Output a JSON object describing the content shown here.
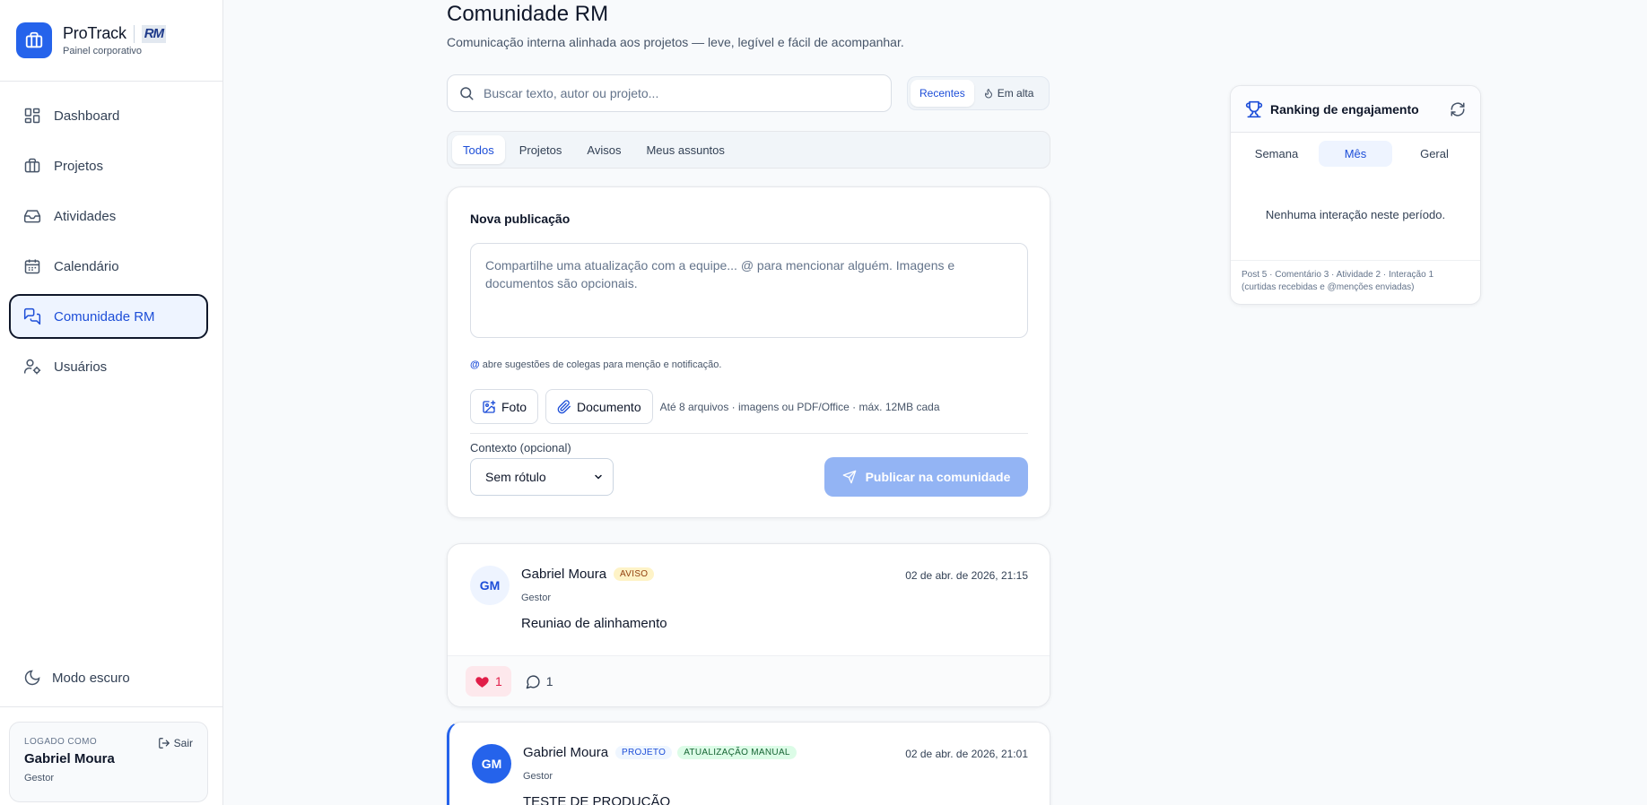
{
  "brand": {
    "name": "ProTrack",
    "badge": "RM",
    "subtitle": "Painel corporativo"
  },
  "sidebar": {
    "items": [
      {
        "label": "Dashboard",
        "icon": "dashboard-icon",
        "active": false
      },
      {
        "label": "Projetos",
        "icon": "briefcase-icon",
        "active": false
      },
      {
        "label": "Atividades",
        "icon": "inbox-icon",
        "active": false
      },
      {
        "label": "Calendário",
        "icon": "calendar-icon",
        "active": false
      },
      {
        "label": "Comunidade RM",
        "icon": "messages-icon",
        "active": true
      },
      {
        "label": "Usuários",
        "icon": "user-settings-icon",
        "active": false
      }
    ],
    "dark_mode_label": "Modo escuro",
    "user": {
      "label": "LOGADO COMO",
      "name": "Gabriel Moura",
      "role": "Gestor",
      "logout": "Sair"
    }
  },
  "header": {
    "title": "Comunidade RM",
    "subtitle": "Comunicação interna alinhada aos projetos — leve, legível e fácil de acompanhar."
  },
  "search": {
    "placeholder": "Buscar texto, autor ou projeto...",
    "value": ""
  },
  "sort": {
    "options": [
      "Recentes",
      "Em alta"
    ],
    "selected": "Recentes"
  },
  "filters": {
    "tabs": [
      "Todos",
      "Projetos",
      "Avisos",
      "Meus assuntos"
    ],
    "selected": "Todos"
  },
  "composer": {
    "title": "Nova publicação",
    "placeholder": "Compartilhe uma atualização com a equipe... @ para mencionar alguém. Imagens e documentos são opcionais.",
    "mention_symbol": "@",
    "mention_hint": "abre sugestões de colegas para menção e notificação.",
    "photo_label": "Foto",
    "document_label": "Documento",
    "attach_note": "Até 8 arquivos · imagens ou PDF/Office · máx. 12MB cada",
    "context_label": "Contexto (opcional)",
    "context_value": "Sem rótulo",
    "publish_label": "Publicar na comunidade"
  },
  "posts": [
    {
      "initials": "GM",
      "author": "Gabriel Moura",
      "badges": [
        "AVISO"
      ],
      "role": "Gestor",
      "date": "02 de abr. de 2026, 21:15",
      "body": "Reuniao de alinhamento",
      "likes": "1",
      "comments": "1"
    },
    {
      "initials": "GM",
      "author": "Gabriel Moura",
      "badges": [
        "PROJETO",
        "ATUALIZAÇÃO MANUAL"
      ],
      "role": "Gestor",
      "date": "02 de abr. de 2026, 21:01",
      "body": "TESTE DE PRODUÇÃO"
    }
  ],
  "ranking": {
    "title": "Ranking de engajamento",
    "tabs": [
      "Semana",
      "Mês",
      "Geral"
    ],
    "selected": "Mês",
    "empty_message": "Nenhuma interação neste período.",
    "footer": "Post 5 · Comentário 3 · Atividade 2 · Interação 1 (curtidas recebidas e @menções enviadas)"
  },
  "colors": {
    "accent": "#2563eb",
    "active_bg": "#eef4ff",
    "like": "#e11d48",
    "publish_disabled": "#93b4f4"
  }
}
